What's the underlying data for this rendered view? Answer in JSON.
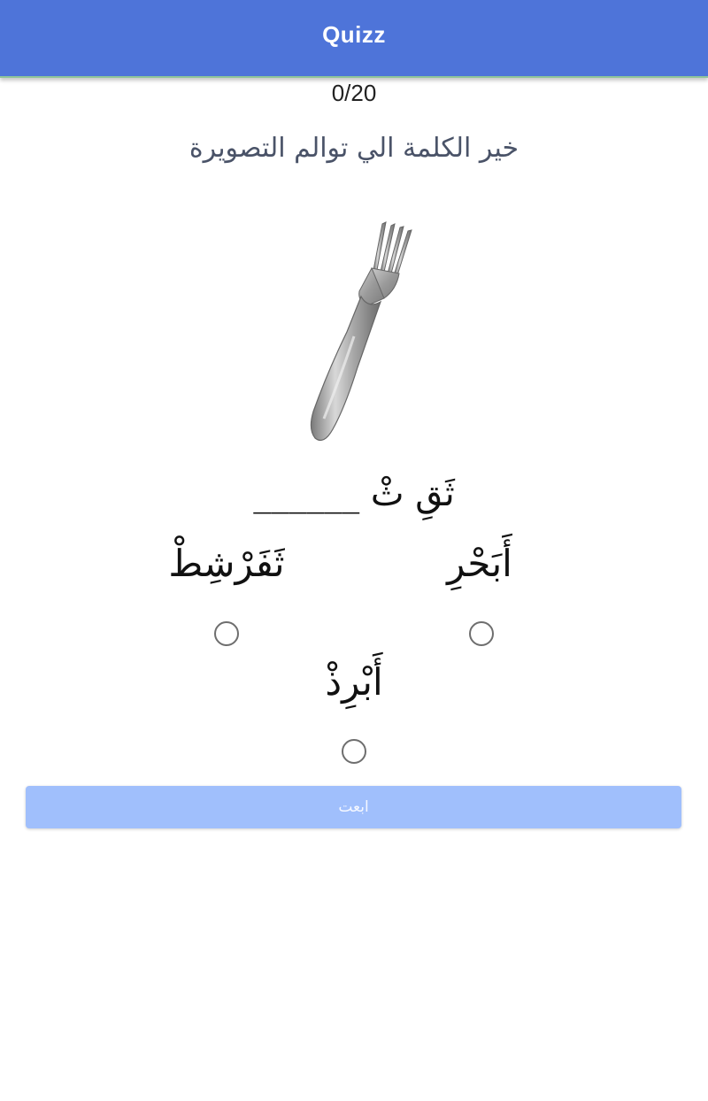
{
  "app_bar": {
    "title": "Quizz",
    "color": "#4e74d9"
  },
  "quiz": {
    "score": "0/20",
    "question": "خير الكلمة الي توالم التصويرة",
    "image_icon": "fork-icon",
    "fill_blank": "ثَقِ ثْ ______"
  },
  "options": [
    {
      "label": "أَبَحْرِ"
    },
    {
      "label": "ثَفَرْشِطْ"
    },
    {
      "label": "أَبْرِذْ"
    }
  ],
  "submit": {
    "label": "ابعت",
    "color": "#a0bffc"
  }
}
